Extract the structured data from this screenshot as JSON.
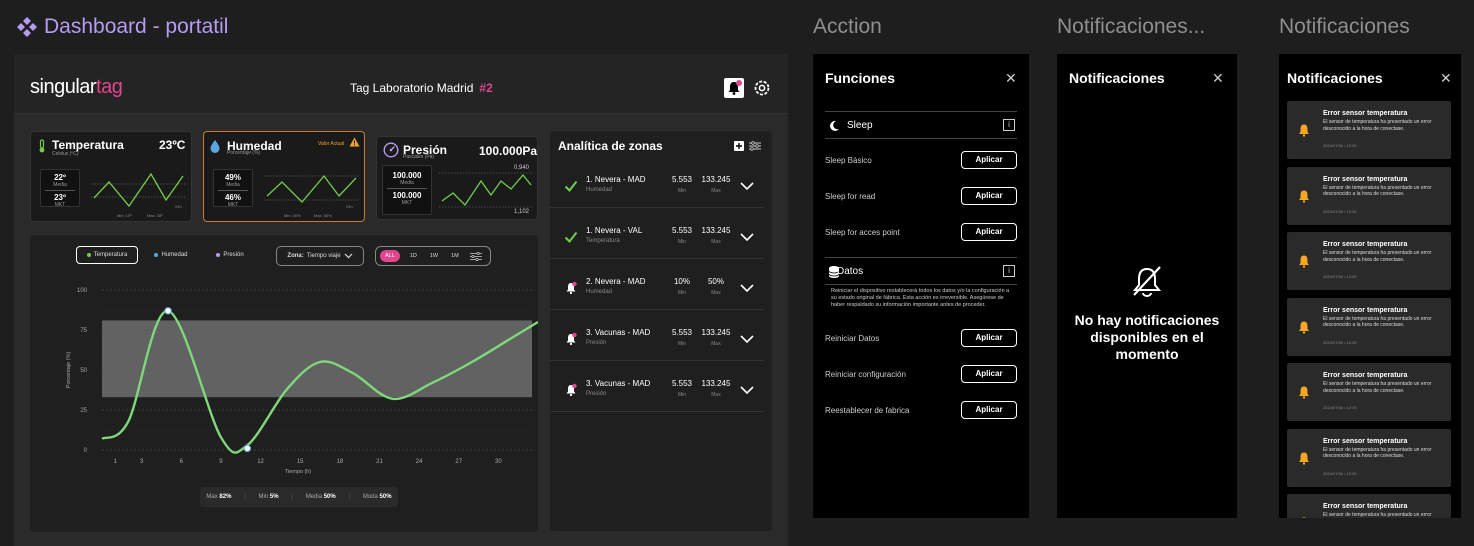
{
  "frames": {
    "dashboard": "Dashboard - portatil",
    "actions": "Acction",
    "notif_empty": "Notificaciones...",
    "notif_list": "Notificaciones"
  },
  "header": {
    "logo_a": "singular",
    "logo_b": "tag",
    "tag_name": "Tag Laboratorio Madrid",
    "tag_num": "#2"
  },
  "cards": {
    "temp": {
      "title": "Temperatura",
      "sub": "Celsius (ºC)",
      "value": "23ºC",
      "a": "22º",
      "a_l": "Media",
      "b": "23º",
      "b_l": "MKT",
      "min_l": "Min: 10º",
      "max_l": "Max: 38º",
      "tick": "24h"
    },
    "hum": {
      "title": "Humedad",
      "sub": "Porcentaje (%)",
      "warn": "Valor Actual",
      "a": "49%",
      "a_l": "Media",
      "b": "46%",
      "b_l": "MKT",
      "min_l": "Min: 40%",
      "max_l": "Max: 55%",
      "tick": "24h"
    },
    "pres": {
      "title": "Presión",
      "sub": "Pascales (Pa)",
      "value": "100.000Pa",
      "a": "100.000",
      "a_l": "Media",
      "b": "100.000",
      "b_l": "MKT",
      "hi": "0,940",
      "lo": "1,102"
    }
  },
  "zones": {
    "title": "Analítica de zonas",
    "rows": [
      {
        "name": "1. Nevera - MAD",
        "sub": "Humedad",
        "v1": "5.553",
        "l1": "Min",
        "v2": "133.245",
        "l2": "Max",
        "status": "ok"
      },
      {
        "name": "1. Nevera - VAL",
        "sub": "Temperatura",
        "v1": "5.553",
        "l1": "Min",
        "v2": "133.245",
        "l2": "Max",
        "status": "ok"
      },
      {
        "name": "2. Nevera - MAD",
        "sub": "Humedad",
        "v1": "10%",
        "l1": "Min",
        "v2": "50%",
        "l2": "Max",
        "status": "alert"
      },
      {
        "name": "3. Vacunas - MAD",
        "sub": "Presión",
        "v1": "5.553",
        "l1": "Min",
        "v2": "133.245",
        "l2": "Max",
        "status": "alert"
      },
      {
        "name": "3. Vacunas - MAD",
        "sub": "Presión",
        "v1": "5.553",
        "l1": "Min",
        "v2": "133.245",
        "l2": "Max",
        "status": "alert"
      }
    ]
  },
  "chart_controls": {
    "legend": [
      "Temperatura",
      "Humedad",
      "Presión"
    ],
    "zone_label": "Zona:",
    "zone_value": "Tiempo viaje",
    "ranges": [
      "ALL",
      "1D",
      "1W",
      "1M"
    ],
    "stats": [
      {
        "label": "Max",
        "value": "82%"
      },
      {
        "label": "Min",
        "value": "5%"
      },
      {
        "label": "Media",
        "value": "50%"
      },
      {
        "label": "Moda",
        "value": "50%"
      }
    ]
  },
  "chart_data": {
    "type": "line",
    "xlabel": "Tiempo (h)",
    "ylabel": "Porcentaje (%)",
    "ylim": [
      0,
      100
    ],
    "xlim": [
      0,
      33
    ],
    "xticks": [
      1,
      3,
      6,
      9,
      12,
      15,
      18,
      21,
      24,
      27,
      30
    ],
    "yticks": [
      0,
      25,
      50,
      75,
      100
    ],
    "band": [
      33,
      81
    ],
    "series": [
      {
        "name": "Temperatura",
        "x": [
          0,
          2,
          5,
          9,
          11,
          14,
          16.5,
          19,
          22,
          25,
          28,
          31,
          33
        ],
        "y": [
          7,
          18,
          87,
          8,
          3,
          38,
          55,
          48,
          32,
          42,
          55,
          70,
          80
        ]
      }
    ],
    "markers": [
      {
        "x": 5,
        "y": 87
      },
      {
        "x": 11,
        "y": 1
      }
    ]
  },
  "functions": {
    "title": "Funciones",
    "sleep_section": "Sleep",
    "sleep_rows": [
      "Sleep Básico",
      "Sleep for read",
      "Sleep for acces point"
    ],
    "data_section": "Datos",
    "data_desc": "Reiniciar el dispositivo restablecerá todos los datos y/o la configuración a su estado original de fábrica. Esta acción es irreversible. Asegúrese de haber respaldado su información importante antes de proceder.",
    "data_rows": [
      "Reiniciar Datos",
      "Reiniciar configuración",
      "Reestablecer de fabrica"
    ],
    "apply": "Aplicar"
  },
  "notif_empty": {
    "title": "Notificaciones",
    "message": "No hay notificaciones disponibles en el momento"
  },
  "notif_list": {
    "title": "Notificaciones",
    "items": [
      {
        "t": "Error sensor temperatura",
        "b": "El sensor de temperatura ha presentado un error desconocido a la hora de conectase.",
        "d": "2024/07/06 • 12:00"
      },
      {
        "t": "Error sensor temperatura",
        "b": "El sensor de temperatura ha presentado un error desconocido a la hora de conectase.",
        "d": "2024/07/06 • 12:00"
      },
      {
        "t": "Error sensor temperatura",
        "b": "El sensor de temperatura ha presentado un error desconocido a la hora de conectase.",
        "d": "2024/07/06 • 12:00"
      },
      {
        "t": "Error sensor temperatura",
        "b": "El sensor de temperatura ha presentado un error desconocido a la hora de conectase.",
        "d": "2024/07/06 • 12:00"
      },
      {
        "t": "Error sensor temperatura",
        "b": "El sensor de temperatura ha presentado un error desconocido a la hora de conectase.",
        "d": "2024/07/06 • 12:00"
      },
      {
        "t": "Error sensor temperatura",
        "b": "El sensor de temperatura ha presentado un error desconocido a la hora de conectase.",
        "d": "2024/07/06 • 12:00"
      },
      {
        "t": "Error sensor temperatura",
        "b": "El sensor de temperatura ha presentado un error desconocido a la hora de conectase.",
        "d": ""
      }
    ]
  },
  "colors": {
    "accent": "#e0458f",
    "purple": "#b59cf0",
    "green": "#6fcf4b",
    "line": "#7fd87a",
    "warn": "#f5a623"
  }
}
